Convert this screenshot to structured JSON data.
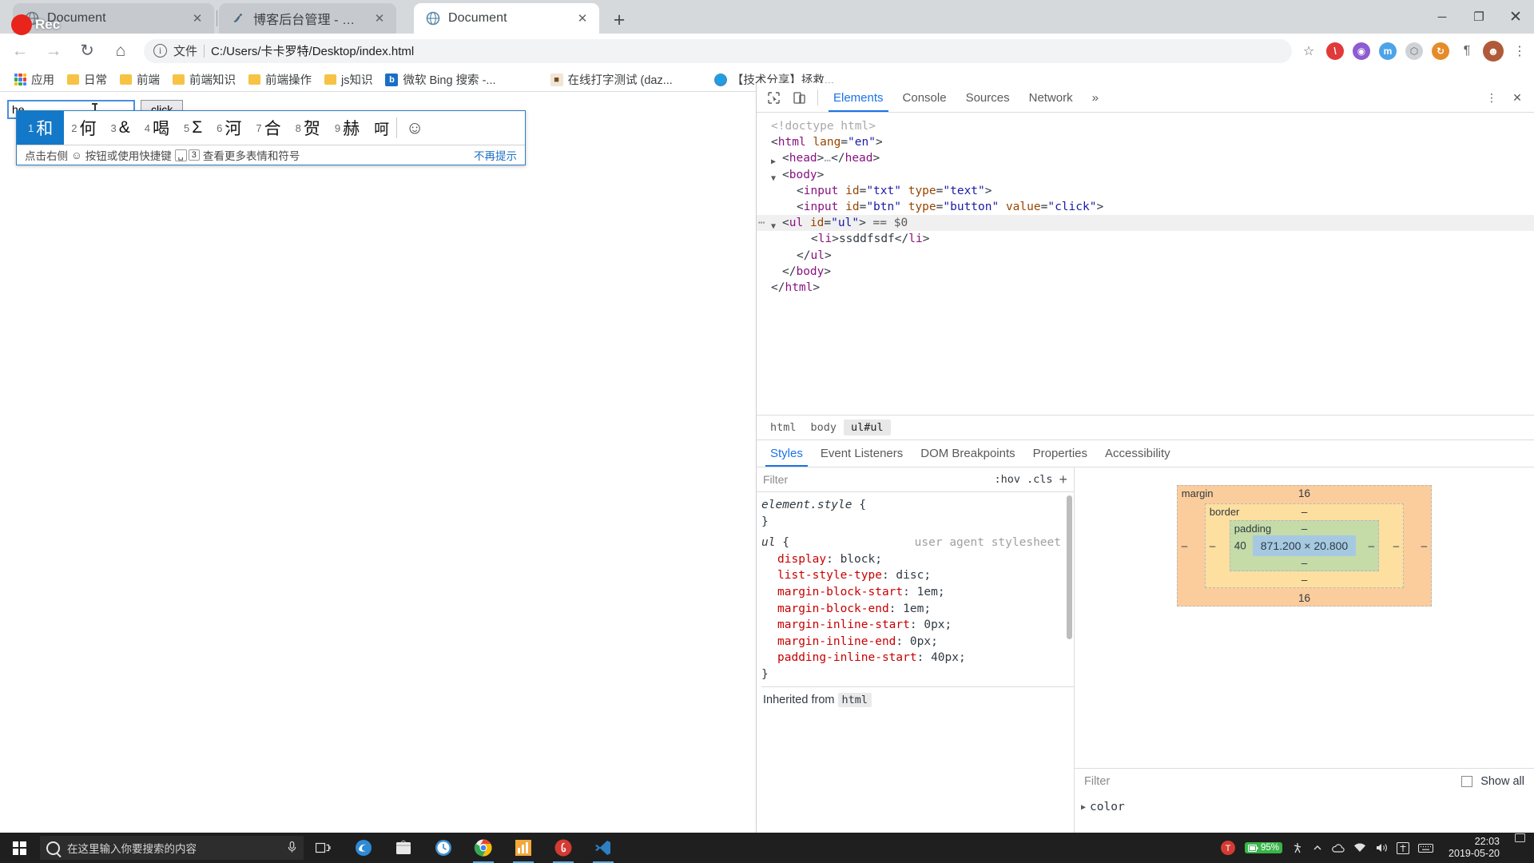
{
  "window": {
    "controls": {
      "minimize": "─",
      "maximize": "❐",
      "close": "✕"
    }
  },
  "tabs": [
    {
      "label": "Document",
      "close": "✕",
      "favicon": "globe-icon",
      "active": false
    },
    {
      "label": "博客后台管理 - 博客园",
      "close": "✕",
      "favicon": "cnblogs-icon",
      "active": false
    },
    {
      "label": "Document",
      "close": "✕",
      "favicon": "globe-icon",
      "active": true
    }
  ],
  "new_tab_label": "+",
  "record_badge": {
    "label": "Rec",
    "color": "#e8241c"
  },
  "toolbar": {
    "back": "←",
    "forward": "→",
    "reload": "↻",
    "home": "⌂",
    "info_icon": "ⓘ",
    "scheme_label": "文件",
    "url": "C:/Users/卡卡罗特/Desktop/index.html",
    "star": "☆",
    "extensions": [
      {
        "name": "adblock-icon",
        "glyph": "●",
        "color": "#e03a3a"
      },
      {
        "name": "extension-purple-icon",
        "glyph": "●",
        "color": "#8e5bd0"
      },
      {
        "name": "extension-blue-icon",
        "glyph": "m",
        "color": "#4da3e8"
      },
      {
        "name": "extension-grey-icon",
        "glyph": "⬡",
        "color": "#9aa0a6"
      },
      {
        "name": "extension-orange-icon",
        "glyph": "↻",
        "color": "#e58b2a"
      },
      {
        "name": "paragraph-icon",
        "glyph": "¶",
        "color": "#5f6368"
      }
    ],
    "avatar": "avatar-icon",
    "menu": "⋮"
  },
  "bookmarks": [
    {
      "label": "应用",
      "icon": "apps-grid-icon"
    },
    {
      "label": "日常",
      "icon": "folder-icon"
    },
    {
      "label": "前端",
      "icon": "folder-icon"
    },
    {
      "label": "前端知识",
      "icon": "folder-icon"
    },
    {
      "label": "前端操作",
      "icon": "folder-icon"
    },
    {
      "label": "js知识",
      "icon": "folder-icon"
    },
    {
      "label": "微软 Bing 搜索 -...",
      "icon": "bing-icon"
    },
    {
      "label": "在线打字测试 (daz...",
      "icon": "typing-test-icon"
    },
    {
      "label": "【技术分享】拯救...",
      "icon": "globe-icon"
    }
  ],
  "page": {
    "text_input_value": "he",
    "text_input_placeholder": "",
    "button_label": "click"
  },
  "ime": {
    "candidates": [
      {
        "num": "1",
        "word": "和",
        "selected": true
      },
      {
        "num": "2",
        "word": "何",
        "selected": false
      },
      {
        "num": "3",
        "word": "&",
        "selected": false
      },
      {
        "num": "4",
        "word": "喝",
        "selected": false
      },
      {
        "num": "5",
        "word": "Σ",
        "selected": false
      },
      {
        "num": "6",
        "word": "河",
        "selected": false
      },
      {
        "num": "7",
        "word": "合",
        "selected": false
      },
      {
        "num": "8",
        "word": "贺",
        "selected": false
      },
      {
        "num": "9",
        "word": "赫",
        "selected": false
      },
      {
        "num": "",
        "word": "呵",
        "selected": false
      }
    ],
    "emoji_button": "☺",
    "hint_prefix": "点击右侧",
    "hint_icon": "☺",
    "hint_middle": "按钮或使用快捷键",
    "hint_key_1": "␣",
    "hint_key_2": "3",
    "hint_suffix": "查看更多表情和符号",
    "dismiss_label": "不再提示"
  },
  "devtools": {
    "inspect_icon": "↖",
    "device_icon": "▭",
    "tabs": [
      {
        "label": "Elements",
        "active": true
      },
      {
        "label": "Console",
        "active": false
      },
      {
        "label": "Sources",
        "active": false
      },
      {
        "label": "Network",
        "active": false
      }
    ],
    "more_tabs": "»",
    "settings": "⋮",
    "close": "✕",
    "dom": [
      {
        "indent": 0,
        "marker": "",
        "html_parts": [
          {
            "cls": "cm",
            "t": "<!doctype html>"
          }
        ]
      },
      {
        "indent": 0,
        "marker": "",
        "html_parts": [
          {
            "cls": "pn",
            "t": "<"
          },
          {
            "cls": "tg",
            "t": "html"
          },
          {
            "cls": "pn",
            "t": " "
          },
          {
            "cls": "at",
            "t": "lang"
          },
          {
            "cls": "pn",
            "t": "="
          },
          {
            "cls": "av",
            "t": "\"en\""
          },
          {
            "cls": "pn",
            "t": ">"
          }
        ]
      },
      {
        "indent": 1,
        "marker": "▶",
        "html_parts": [
          {
            "cls": "pn",
            "t": "<"
          },
          {
            "cls": "tg",
            "t": "head"
          },
          {
            "cls": "pn",
            "t": ">"
          },
          {
            "cls": "cm",
            "t": "…"
          },
          {
            "cls": "pn",
            "t": "</"
          },
          {
            "cls": "tg",
            "t": "head"
          },
          {
            "cls": "pn",
            "t": ">"
          }
        ]
      },
      {
        "indent": 1,
        "marker": "▼",
        "html_parts": [
          {
            "cls": "pn",
            "t": "<"
          },
          {
            "cls": "tg",
            "t": "body"
          },
          {
            "cls": "pn",
            "t": ">"
          }
        ]
      },
      {
        "indent": 2,
        "marker": "",
        "html_parts": [
          {
            "cls": "pn",
            "t": "<"
          },
          {
            "cls": "tg",
            "t": "input"
          },
          {
            "cls": "pn",
            "t": " "
          },
          {
            "cls": "at",
            "t": "id"
          },
          {
            "cls": "pn",
            "t": "="
          },
          {
            "cls": "av",
            "t": "\"txt\""
          },
          {
            "cls": "pn",
            "t": " "
          },
          {
            "cls": "at",
            "t": "type"
          },
          {
            "cls": "pn",
            "t": "="
          },
          {
            "cls": "av",
            "t": "\"text\""
          },
          {
            "cls": "pn",
            "t": ">"
          }
        ]
      },
      {
        "indent": 2,
        "marker": "",
        "html_parts": [
          {
            "cls": "pn",
            "t": "<"
          },
          {
            "cls": "tg",
            "t": "input"
          },
          {
            "cls": "pn",
            "t": " "
          },
          {
            "cls": "at",
            "t": "id"
          },
          {
            "cls": "pn",
            "t": "="
          },
          {
            "cls": "av",
            "t": "\"btn\""
          },
          {
            "cls": "pn",
            "t": " "
          },
          {
            "cls": "at",
            "t": "type"
          },
          {
            "cls": "pn",
            "t": "="
          },
          {
            "cls": "av",
            "t": "\"button\""
          },
          {
            "cls": "pn",
            "t": " "
          },
          {
            "cls": "at",
            "t": "value"
          },
          {
            "cls": "pn",
            "t": "="
          },
          {
            "cls": "av",
            "t": "\"click\""
          },
          {
            "cls": "pn",
            "t": ">"
          }
        ]
      },
      {
        "indent": 1,
        "marker": "▼",
        "dots": "…",
        "highlight": true,
        "html_parts": [
          {
            "cls": "pn",
            "t": "<"
          },
          {
            "cls": "tg",
            "t": "ul"
          },
          {
            "cls": "pn",
            "t": " "
          },
          {
            "cls": "at",
            "t": "id"
          },
          {
            "cls": "pn",
            "t": "="
          },
          {
            "cls": "av",
            "t": "\"ul\""
          },
          {
            "cls": "pn",
            "t": "> "
          },
          {
            "cls": "dollar",
            "t": "== $0"
          }
        ]
      },
      {
        "indent": 3,
        "marker": "",
        "html_parts": [
          {
            "cls": "pn",
            "t": "<"
          },
          {
            "cls": "tg",
            "t": "li"
          },
          {
            "cls": "pn",
            "t": ">"
          },
          {
            "cls": "txtnode",
            "t": "ssddfsdf"
          },
          {
            "cls": "pn",
            "t": "</"
          },
          {
            "cls": "tg",
            "t": "li"
          },
          {
            "cls": "pn",
            "t": ">"
          }
        ]
      },
      {
        "indent": 2,
        "marker": "",
        "html_parts": [
          {
            "cls": "pn",
            "t": "</"
          },
          {
            "cls": "tg",
            "t": "ul"
          },
          {
            "cls": "pn",
            "t": ">"
          }
        ]
      },
      {
        "indent": 1,
        "marker": "",
        "html_parts": [
          {
            "cls": "pn",
            "t": "</"
          },
          {
            "cls": "tg",
            "t": "body"
          },
          {
            "cls": "pn",
            "t": ">"
          }
        ]
      },
      {
        "indent": 0,
        "marker": "",
        "html_parts": [
          {
            "cls": "pn",
            "t": "</"
          },
          {
            "cls": "tg",
            "t": "html"
          },
          {
            "cls": "pn",
            "t": ">"
          }
        ]
      }
    ],
    "breadcrumbs": [
      {
        "label": "html",
        "active": false
      },
      {
        "label": "body",
        "active": false
      },
      {
        "label": "ul#ul",
        "active": true
      }
    ],
    "subtabs": [
      {
        "label": "Styles",
        "active": true
      },
      {
        "label": "Event Listeners",
        "active": false
      },
      {
        "label": "DOM Breakpoints",
        "active": false
      },
      {
        "label": "Properties",
        "active": false
      },
      {
        "label": "Accessibility",
        "active": false
      }
    ],
    "styles_filter_placeholder": "Filter",
    "hov_label": ":hov",
    "cls_label": ".cls",
    "add_rule": "+",
    "rules": [
      {
        "selector": "element.style",
        "source": "",
        "declarations": []
      },
      {
        "selector": "ul",
        "source": "user agent stylesheet",
        "declarations": [
          {
            "prop": "display",
            "value": "block"
          },
          {
            "prop": "list-style-type",
            "value": "disc"
          },
          {
            "prop": "margin-block-start",
            "value": "1em"
          },
          {
            "prop": "margin-block-end",
            "value": "1em"
          },
          {
            "prop": "margin-inline-start",
            "value": "0px"
          },
          {
            "prop": "margin-inline-end",
            "value": "0px"
          },
          {
            "prop": "padding-inline-start",
            "value": "40px"
          }
        ]
      }
    ],
    "inherited_from_label": "Inherited from",
    "inherited_from_value": "html",
    "box_model": {
      "margin_label": "margin",
      "margin_top": "16",
      "margin_bottom": "16",
      "margin_left": "–",
      "margin_right": "–",
      "border_label": "border",
      "border_top": "–",
      "border_bottom": "–",
      "border_left": "–",
      "border_right": "–",
      "padding_label": "padding",
      "padding_top": "–",
      "padding_bottom": "–",
      "padding_left": "40",
      "padding_right": "–",
      "content": "871.200 × 20.800"
    },
    "computed_filter_placeholder": "Filter",
    "show_all_label": "Show all",
    "computed_section": "color"
  },
  "taskbar": {
    "start_icon": "windows-logo-icon",
    "search_placeholder": "在这里输入你要搜索的内容",
    "mic_icon": "ⲗ",
    "taskview_icon": "⌸",
    "apps": [
      {
        "name": "edge-icon",
        "glyph": "e",
        "color": "#2e8ad6",
        "running": false
      },
      {
        "name": "store-icon",
        "glyph": "⊞",
        "color": "#d8d8d8",
        "running": false
      },
      {
        "name": "clock-icon",
        "glyph": "◔",
        "color": "#4a9ed8",
        "running": false
      },
      {
        "name": "chrome-icon",
        "glyph": "◉",
        "color": "#e6e6e6",
        "running": true
      },
      {
        "name": "chart-app-icon",
        "glyph": "◧",
        "color": "#f2a93b",
        "running": true
      },
      {
        "name": "netease-music-icon",
        "glyph": "♪",
        "color": "#d33b33",
        "running": true
      },
      {
        "name": "vscode-icon",
        "glyph": "⌨",
        "color": "#2f7fc4",
        "running": true
      }
    ],
    "tray": [
      {
        "name": "thunder-icon",
        "glyph": "T",
        "color": "#d33b33"
      },
      {
        "name": "battery-icon",
        "glyph": "95%",
        "color": "#3ab54a"
      },
      {
        "name": "accessibility-icon",
        "glyph": "⁂"
      },
      {
        "name": "chevron-up-icon",
        "glyph": "∧"
      },
      {
        "name": "onedrive-icon",
        "glyph": "☁"
      },
      {
        "name": "wifi-icon",
        "glyph": "◠"
      },
      {
        "name": "volume-icon",
        "glyph": "◂)"
      },
      {
        "name": "ime-icon",
        "glyph": "中"
      },
      {
        "name": "keyboard-icon",
        "glyph": "⌨"
      }
    ],
    "time": "22:03",
    "date": "2019-05-20",
    "notifications_icon": "▭"
  }
}
